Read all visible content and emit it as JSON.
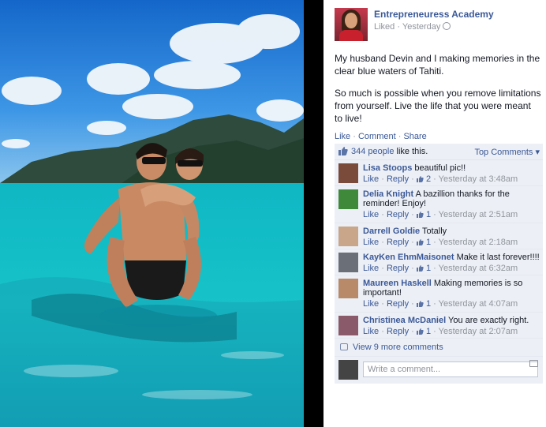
{
  "post": {
    "page_name": "Entrepreneuress Academy",
    "meta": "Liked · Yesterday",
    "paragraph1": "My husband Devin and I making memories in the clear blue waters of Tahiti.",
    "paragraph2": "So much is possible when you remove limitations from yourself. Live the life that you were meant to live!"
  },
  "actions": {
    "like": "Like",
    "comment": "Comment",
    "share": "Share"
  },
  "ufi": {
    "likes_count": "344 people",
    "likes_suffix": "like this.",
    "top_comments": "Top Comments ▾",
    "view_more": "View 9 more comments",
    "write_placeholder": "Write a comment..."
  },
  "comments": [
    {
      "name": "Lisa Stoops",
      "text": "beautiful pic!!",
      "like": "Like",
      "reply": "Reply",
      "likes": "2",
      "time": "Yesterday at 3:48am",
      "avatar_color": "#7a4a3a"
    },
    {
      "name": "Delia Knight",
      "text": "A bazillion thanks for the reminder! Enjoy!",
      "like": "Like",
      "reply": "Reply",
      "likes": "1",
      "time": "Yesterday at 2:51am",
      "avatar_color": "#3f8a3a"
    },
    {
      "name": "Darrell Goldie",
      "text": "Totally",
      "like": "Like",
      "reply": "Reply",
      "likes": "1",
      "time": "Yesterday at 2:18am",
      "avatar_color": "#c9a68a"
    },
    {
      "name": "KayKen EhmMaisonet",
      "text": "Make it last forever!!!!",
      "like": "Like",
      "reply": "Reply",
      "likes": "1",
      "time": "Yesterday at 6:32am",
      "avatar_color": "#6b6f78"
    },
    {
      "name": "Maureen Haskell",
      "text": "Making memories is so important!",
      "like": "Like",
      "reply": "Reply",
      "likes": "1",
      "time": "Yesterday at 4:07am",
      "avatar_color": "#b88a6a"
    },
    {
      "name": "Christinea McDaniel",
      "text": "You are exactly right.",
      "like": "Like",
      "reply": "Reply",
      "likes": "1",
      "time": "Yesterday at 2:07am",
      "avatar_color": "#8a5a6a"
    }
  ]
}
